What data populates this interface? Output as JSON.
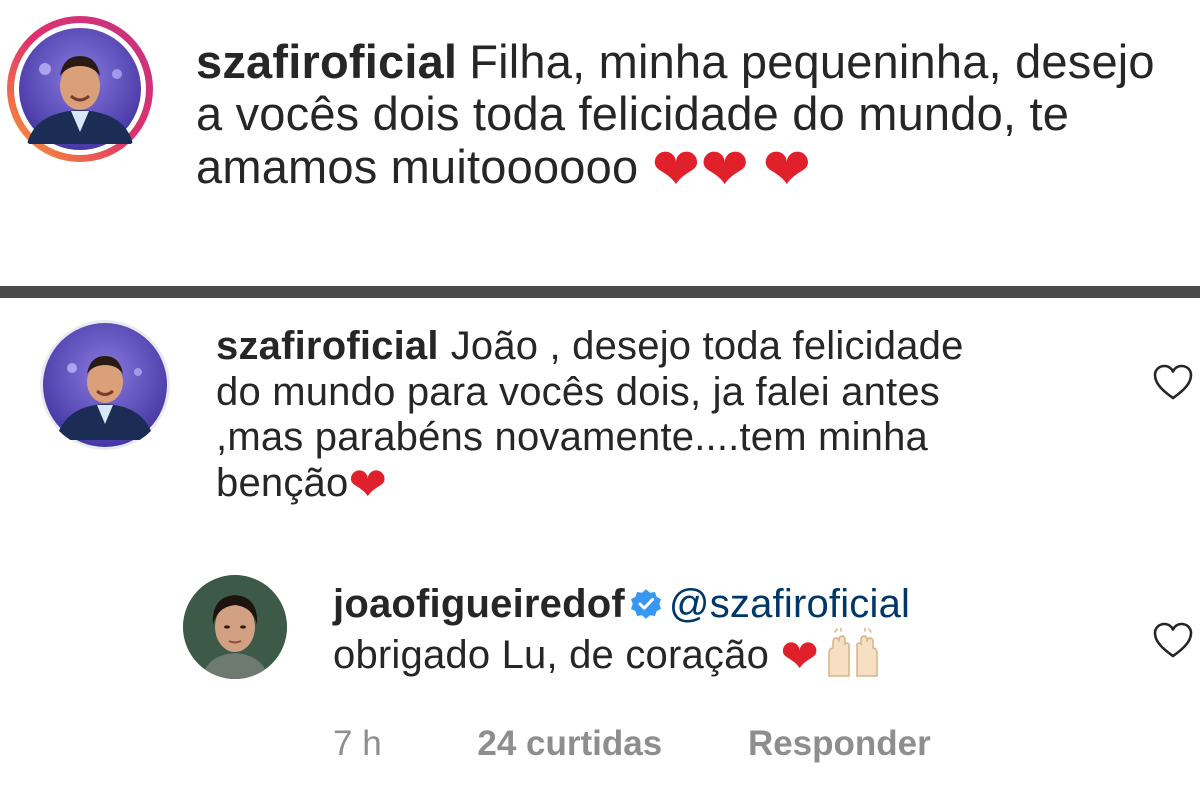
{
  "top_comment": {
    "username": "szafiroficial",
    "text": "Filha, minha pequeninha, desejo a vocês dois toda felicidade do mundo, te amamos muitoooooo",
    "hearts": [
      "❤",
      "❤",
      "❤"
    ]
  },
  "bottom_comment": {
    "username": "szafiroficial",
    "text": "João , desejo toda felicidade do mundo para vocês dois, ja falei antes ,mas parabéns novamente....tem minha benção",
    "heart": "❤"
  },
  "reply": {
    "username": "joaofigueiredof",
    "mention": "@szafiroficial",
    "text": "obrigado Lu, de coração",
    "heart": "❤",
    "time": "7 h",
    "likes": "24 curtidas",
    "reply_label": "Responder"
  },
  "icons": {
    "like": "heart-outline-icon",
    "verified": "verified-badge-icon",
    "hands": "raised-hands-emoji"
  },
  "colors": {
    "text": "#262626",
    "muted": "#8e8e8e",
    "heart": "#e0202a",
    "verified": "#3897f0",
    "divider": "#4a4a4a",
    "story_ring": "#c13584"
  }
}
